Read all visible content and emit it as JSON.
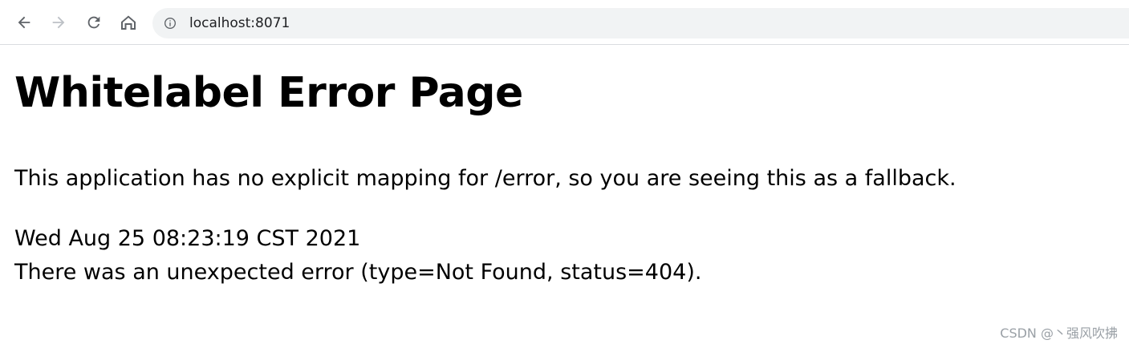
{
  "browser": {
    "url": "localhost:8071",
    "icons": {
      "back": "arrow-left-icon",
      "forward": "arrow-right-icon",
      "reload": "reload-icon",
      "home": "home-icon",
      "site_info": "info-icon"
    },
    "forward_disabled": true
  },
  "page": {
    "title": "Whitelabel Error Page",
    "message": "This application has no explicit mapping for /error, so you are seeing this as a fallback.",
    "timestamp": "Wed Aug 25 08:23:19 CST 2021",
    "error": "There was an unexpected error (type=Not Found, status=404)."
  },
  "watermark": "CSDN @丶强风吹拂",
  "colors": {
    "toolbar_icon": "#5f6368",
    "toolbar_icon_disabled": "#bdc1c6",
    "omnibox_bg": "#f1f3f4",
    "text": "#000000"
  }
}
